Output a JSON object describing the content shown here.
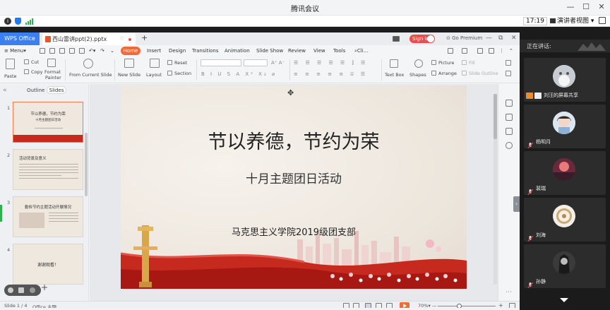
{
  "meeting": {
    "title": "腾讯会议",
    "time": "17:19",
    "view_button": "演讲者视图",
    "view_dropdown": "▾",
    "minimize_glyph": "—",
    "restore_glyph": "☐",
    "close_glyph": "✕"
  },
  "wps": {
    "app_tab": "WPS Office",
    "doc_tab": "西山雷讲ppt(2).pptx",
    "sign_in": "Sign in",
    "go_premium": "Go Premium",
    "ribbon_tabs": [
      "Menu",
      "Home",
      "Insert",
      "Design",
      "Transitions",
      "Animation",
      "Slide Show",
      "Review",
      "View",
      "Tools",
      "Cli..."
    ],
    "ribbon": {
      "paste": "Paste",
      "cut": "Cut",
      "copy": "Copy",
      "format_painter_1": "Format",
      "format_painter_2": "Painter",
      "from_current_slide": "From Current Slide",
      "new_slide": "New Slide",
      "layout": "Layout",
      "reset": "Reset",
      "section": "Section",
      "text_box": "Text Box",
      "shapes": "Shapes",
      "picture": "Picture",
      "arrange": "Arrange",
      "fill": "Fill",
      "slide_outline": "Slide Outline",
      "format_glyphs": "B  I  U  S  A  X²  X₂  ⌀"
    },
    "left_pane": {
      "outline_tab": "Outline",
      "slides_tab": "Slides",
      "collapse_glyph": "«",
      "add_glyph": "+",
      "thumbs": [
        {
          "num": "1",
          "title": "节以养德，节约为荣",
          "sub": "十月主题团日活动"
        },
        {
          "num": "2",
          "title": "活动背景及意义"
        },
        {
          "num": "3",
          "title": "勤俭节约主题活动开展情况"
        },
        {
          "num": "4",
          "title": "谢谢观看！"
        }
      ]
    },
    "slide": {
      "title": "节以养德，节约为荣",
      "subtitle": "十月主题团日活动",
      "org": "马克思主义学院2019级团支部"
    },
    "status": {
      "slide_label": "Slide 1 / 4",
      "theme_label": "Office 主题",
      "zoom": "70%",
      "zoom_minus": "—",
      "zoom_plus": "+"
    }
  },
  "panel": {
    "header": "正在讲话:",
    "participants": [
      {
        "name": "刘汪的屏幕共享"
      },
      {
        "name": "杨明月"
      },
      {
        "name": "裴瑞"
      },
      {
        "name": "刘海"
      },
      {
        "name": "孙静"
      }
    ]
  },
  "colors": {
    "accent_orange": "#f06a3a",
    "wps_blue": "#3b7ff5",
    "sign_in_red": "#ee4b4b",
    "banner_red": "#c62a1f"
  }
}
